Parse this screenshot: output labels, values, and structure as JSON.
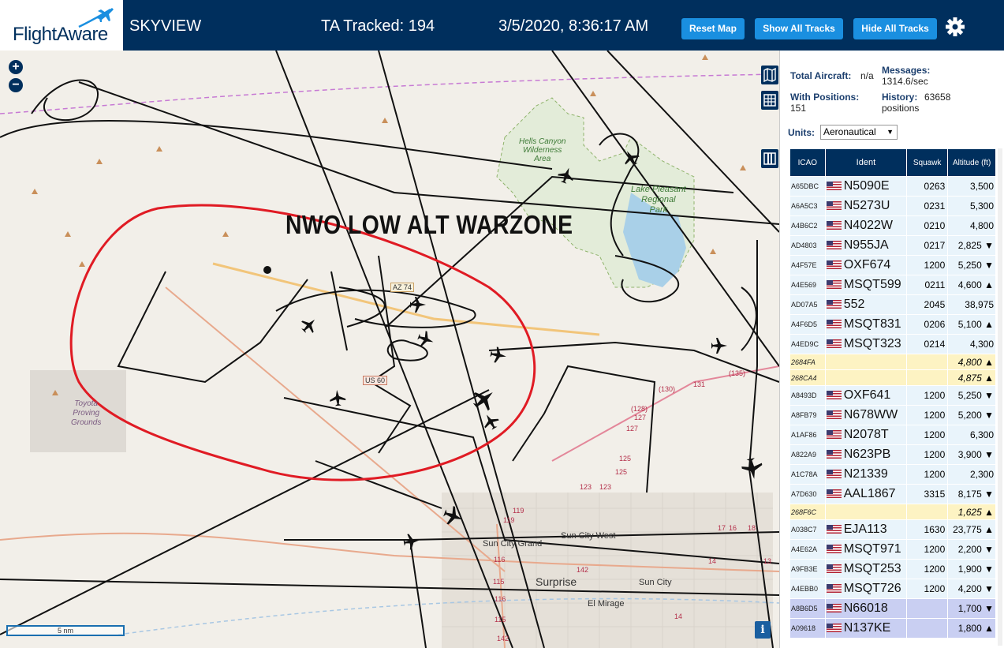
{
  "header": {
    "brand": "FlightAware",
    "app_name": "SKYVIEW",
    "tracked": "TA Tracked: 194",
    "datetime": "3/5/2020, 8:36:17 AM",
    "buttons": {
      "reset": "Reset Map",
      "show_all": "Show All Tracks",
      "hide_all": "Hide All Tracks"
    },
    "settings_icon": "gear-icon",
    "colors": {
      "header_bg": "#002f5d",
      "button_bg": "#1a8fe0"
    }
  },
  "map": {
    "zoom_in": "+",
    "zoom_out": "−",
    "annotation": "NWO LOW ALT WARZONE",
    "labels": {
      "hells_canyon": [
        "Hells Canyon",
        "Wilderness",
        "Area"
      ],
      "lake_pleasant": [
        "Lake Pleasant",
        "Regional",
        "Park"
      ],
      "toyota": [
        "Toyota",
        "Proving",
        "Grounds"
      ],
      "sun_city_grand": "Sun City Grand",
      "sun_city_west": "Sun City West",
      "surprise": "Surprise",
      "sun_city": "Sun City",
      "el_mirage": "El Mirage",
      "az74": "AZ 74",
      "us60": "US 60"
    },
    "road_numbers": [
      "(135)",
      "(130)",
      "131",
      "(128)",
      "127",
      "127",
      "125",
      "125",
      "123",
      "123",
      "119",
      "119",
      "116",
      "115",
      "116",
      "115",
      "142",
      "17",
      "16",
      "18",
      "14",
      "14",
      "13"
    ],
    "scale_label": "5 nm",
    "info_label": "i",
    "side_icons": [
      "map-layers-icon",
      "grid-icon",
      "columns-icon"
    ]
  },
  "sidebar": {
    "total_aircraft_label": "Total Aircraft:",
    "total_aircraft_value": "n/a",
    "messages_label": "Messages:",
    "messages_value": "1314.6/sec",
    "with_positions_label": "With Positions:",
    "with_positions_value": "151",
    "history_label": "History:",
    "history_value": "63658",
    "history_unit": "positions",
    "units_label": "Units:",
    "units_value": "Aeronautical",
    "columns": [
      "ICAO",
      "Ident",
      "Squawk",
      "Altitude (ft)"
    ],
    "rows": [
      {
        "icao": "A65DBC",
        "ident": "N5090E",
        "squawk": "0263",
        "alt": "3,500",
        "type": "adsb"
      },
      {
        "icao": "A6A5C3",
        "ident": "N5273U",
        "squawk": "0231",
        "alt": "5,300",
        "type": "adsb"
      },
      {
        "icao": "A4B6C2",
        "ident": "N4022W",
        "squawk": "0210",
        "alt": "4,800",
        "type": "adsb"
      },
      {
        "icao": "AD4803",
        "ident": "N955JA",
        "squawk": "0217",
        "alt": "2,825 ▼",
        "type": "adsb"
      },
      {
        "icao": "A4F57E",
        "ident": "OXF674",
        "squawk": "1200",
        "alt": "5,250 ▼",
        "type": "adsb"
      },
      {
        "icao": "A4E569",
        "ident": "MSQT599",
        "squawk": "0211",
        "alt": "4,600 ▲",
        "type": "adsb"
      },
      {
        "icao": "AD07A5",
        "ident": "552",
        "squawk": "2045",
        "alt": "38,975",
        "type": "adsb"
      },
      {
        "icao": "A4F6D5",
        "ident": "MSQT831",
        "squawk": "0206",
        "alt": "5,100 ▲",
        "type": "adsb"
      },
      {
        "icao": "A4ED9C",
        "ident": "MSQT323",
        "squawk": "0214",
        "alt": "4,300",
        "type": "adsb"
      },
      {
        "icao": "2684FA",
        "ident": "",
        "squawk": "",
        "alt": "4,800 ▲",
        "type": "mlat"
      },
      {
        "icao": "268CA4",
        "ident": "",
        "squawk": "",
        "alt": "4,875 ▲",
        "type": "mlat"
      },
      {
        "icao": "A8493D",
        "ident": "OXF641",
        "squawk": "1200",
        "alt": "5,250 ▼",
        "type": "adsb"
      },
      {
        "icao": "A8FB79",
        "ident": "N678WW",
        "squawk": "1200",
        "alt": "5,200 ▼",
        "type": "adsb"
      },
      {
        "icao": "A1AF86",
        "ident": "N2078T",
        "squawk": "1200",
        "alt": "6,300",
        "type": "adsb"
      },
      {
        "icao": "A822A9",
        "ident": "N623PB",
        "squawk": "1200",
        "alt": "3,900 ▼",
        "type": "adsb"
      },
      {
        "icao": "A1C78A",
        "ident": "N21339",
        "squawk": "1200",
        "alt": "2,300",
        "type": "adsb"
      },
      {
        "icao": "A7D630",
        "ident": "AAL1867",
        "squawk": "3315",
        "alt": "8,175 ▼",
        "type": "adsb"
      },
      {
        "icao": "268F6C",
        "ident": "",
        "squawk": "",
        "alt": "1,625 ▲",
        "type": "mlat"
      },
      {
        "icao": "A038C7",
        "ident": "EJA113",
        "squawk": "1630",
        "alt": "23,775 ▲",
        "type": "adsb"
      },
      {
        "icao": "A4E62A",
        "ident": "MSQT971",
        "squawk": "1200",
        "alt": "2,200 ▼",
        "type": "adsb"
      },
      {
        "icao": "A9FB3E",
        "ident": "MSQT253",
        "squawk": "1200",
        "alt": "1,900 ▼",
        "type": "adsb"
      },
      {
        "icao": "A4EBB0",
        "ident": "MSQT726",
        "squawk": "1200",
        "alt": "4,200 ▼",
        "type": "adsb"
      },
      {
        "icao": "A8B6D5",
        "ident": "N66018",
        "squawk": "",
        "alt": "1,700 ▼",
        "type": "adsr"
      },
      {
        "icao": "A09618",
        "ident": "N137KE",
        "squawk": "",
        "alt": "1,800 ▲",
        "type": "adsr"
      }
    ]
  }
}
